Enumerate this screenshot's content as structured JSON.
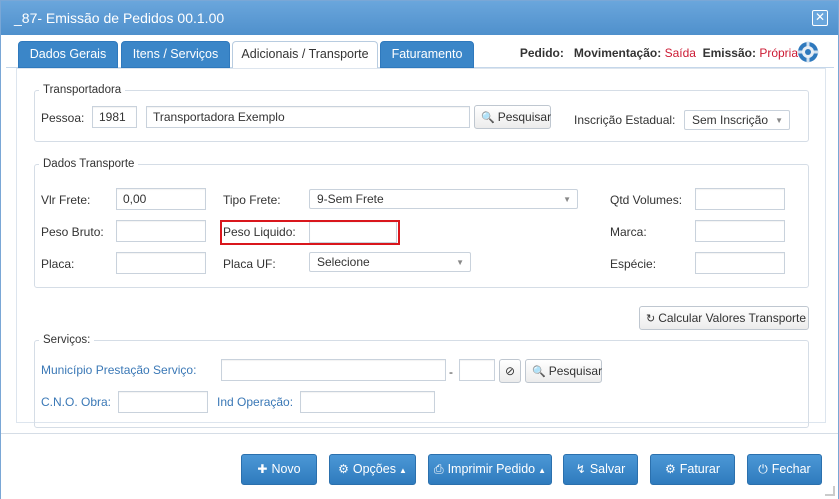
{
  "window": {
    "title": "_87- Emissão de Pedidos 00.1.00",
    "close_label": "✕"
  },
  "tabs": [
    {
      "label": "Dados Gerais",
      "active": false
    },
    {
      "label": "Itens / Serviços",
      "active": false
    },
    {
      "label": "Adicionais / Transporte",
      "active": true
    },
    {
      "label": "Faturamento",
      "active": false
    }
  ],
  "pedido": {
    "label": "Pedido:",
    "movimentacao_label": "Movimentação:",
    "movimentacao_value": "Saída",
    "emissao_label": "Emissão:",
    "emissao_value": "Própria"
  },
  "transportadora": {
    "legend": "Transportadora",
    "pessoa_label": "Pessoa:",
    "pessoa_code": "1981",
    "pessoa_name": "Transportadora Exemplo",
    "search_label": "Pesquisar",
    "ie_label": "Inscrição Estadual:",
    "ie_value": "Sem Inscrição"
  },
  "dados_transporte": {
    "legend": "Dados Transporte",
    "vlr_frete_label": "Vlr Frete:",
    "vlr_frete_value": "0,00",
    "tipo_frete_label": "Tipo Frete:",
    "tipo_frete_value": "9-Sem Frete",
    "qtd_volumes_label": "Qtd Volumes:",
    "peso_bruto_label": "Peso Bruto:",
    "peso_liquido_label": "Peso Liquido:",
    "marca_label": "Marca:",
    "placa_label": "Placa:",
    "placa_uf_label": "Placa UF:",
    "placa_uf_value": "Selecione",
    "especie_label": "Espécie:"
  },
  "calcular_label": "Calcular Valores Transporte",
  "servicos": {
    "legend": "Serviços:",
    "municipio_label": "Município Prestação Serviço:",
    "dash": "-",
    "search_label": "Pesquisar",
    "cno_label": "C.N.O. Obra:",
    "ind_operacao_label": "Ind Operação:"
  },
  "footer": {
    "novo": "Novo",
    "opcoes": "Opções",
    "imprimir": "Imprimir Pedido",
    "salvar": "Salvar",
    "faturar": "Faturar",
    "fechar": "Fechar"
  },
  "colors": {
    "primary": "#3b86c8",
    "title": "#5b9bd5",
    "highlight": "#d9161c",
    "accent_red": "#cc1a33"
  }
}
